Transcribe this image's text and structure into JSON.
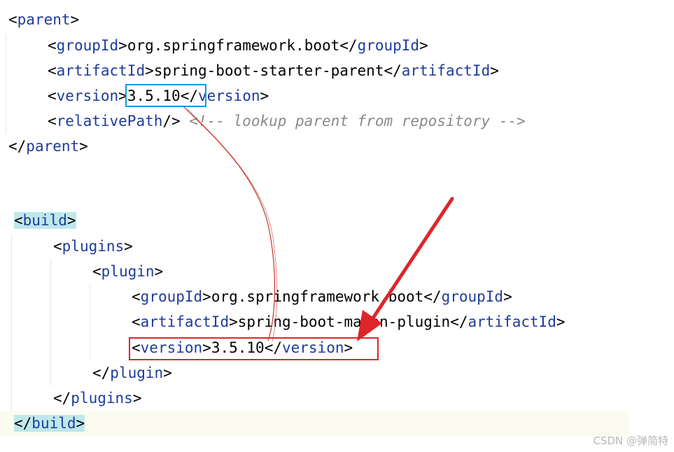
{
  "colors": {
    "tag": "#1f3b9b",
    "comment": "#8a8a8a",
    "brace_highlight": "#bfe8ea",
    "box_blue": "#1a9ad8",
    "box_red": "#e0242b",
    "arrow_red": "#e0242b",
    "connector": "#c0392b"
  },
  "parent": {
    "open_tag": "parent",
    "group_tag": "groupId",
    "group_value": "org.springframework.boot",
    "artifact_tag": "artifactId",
    "artifact_value": "spring-boot-starter-parent",
    "version_tag": "version",
    "version_value": "3.5.10",
    "relative_tag": "relativePath",
    "relative_comment": "<!-- lookup parent from repository -->"
  },
  "build": {
    "build_tag": "build",
    "plugins_tag": "plugins",
    "plugin_tag": "plugin",
    "group_tag": "groupId",
    "group_value": "org.springframework.boot",
    "artifact_tag": "artifactId",
    "artifact_value": "spring-boot-maven-plugin",
    "version_tag": "version",
    "version_value": "3.5.10"
  },
  "watermark": "CSDN @弹简特"
}
